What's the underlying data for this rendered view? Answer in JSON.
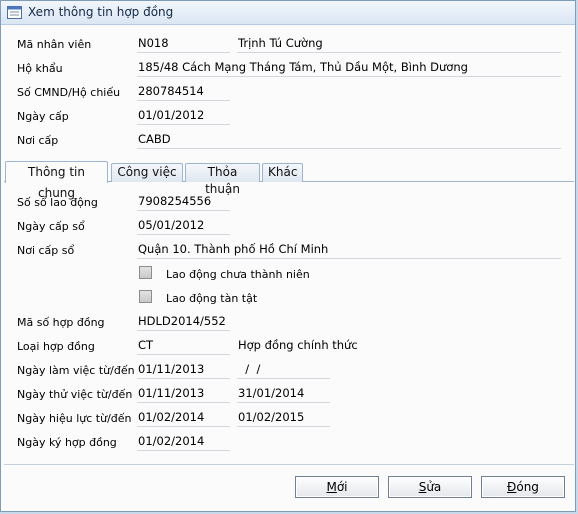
{
  "window": {
    "title": "Xem thông tin hợp đồng"
  },
  "employee": {
    "ma_nv_label": "Mã nhân viên",
    "ma_nv": "N018",
    "ten": "Trịnh Tú Cường",
    "ho_khau_label": "Hộ khẩu",
    "ho_khau": "185/48 Cách Mạng Tháng Tám, Thủ Dầu Một, Bình Dương",
    "cmnd_label": "Số CMND/Hộ chiếu",
    "cmnd": "280784514",
    "ngay_cap_label": "Ngày cấp",
    "ngay_cap": "01/01/2012",
    "noi_cap_label": "Nơi cấp",
    "noi_cap": "CABD"
  },
  "tabs": [
    {
      "label": "Thông tin chung",
      "active": true
    },
    {
      "label": "Công việc"
    },
    {
      "label": "Thỏa thuận"
    },
    {
      "label": "Khác"
    }
  ],
  "general": {
    "so_sld_label": "Số sổ lao động",
    "so_sld": "7908254556",
    "ngay_cap_so_label": "Ngày cấp sổ",
    "ngay_cap_so": "05/01/2012",
    "noi_cap_so_label": "Nơi cấp sổ",
    "noi_cap_so": "Quận 10. Thành phố Hồ Chí Minh",
    "chk_chua_thanh_nien": "Lao động chưa thành niên",
    "chk_tan_tat": "Lao động tàn tật",
    "ma_so_hd_label": "Mã số hợp đồng",
    "ma_so_hd": "HDLD2014/552",
    "loai_hd_label": "Loại hợp đồng",
    "loai_hd_code": "CT",
    "loai_hd_name": "Hợp đồng chính thức",
    "ngay_lam_viec_label": "Ngày làm việc từ/đến",
    "ngay_lam_viec_tu": "01/11/2013",
    "ngay_lam_viec_den": "  /  /",
    "ngay_thu_viec_label": "Ngày thử việc từ/đến",
    "ngay_thu_viec_tu": "01/11/2013",
    "ngay_thu_viec_den": "31/01/2014",
    "ngay_hieu_luc_label": "Ngày hiệu lực từ/đến",
    "ngay_hieu_luc_tu": "01/02/2014",
    "ngay_hieu_luc_den": "01/02/2015",
    "ngay_ky_label": "Ngày ký hợp đồng",
    "ngay_ky": "01/02/2014"
  },
  "buttons": {
    "moi_prefix": "",
    "moi_u": "M",
    "moi_rest": "ới",
    "sua_prefix": "",
    "sua_u": "S",
    "sua_rest": "ửa",
    "dong_prefix": "",
    "dong_u": "Đ",
    "dong_rest": "óng"
  }
}
